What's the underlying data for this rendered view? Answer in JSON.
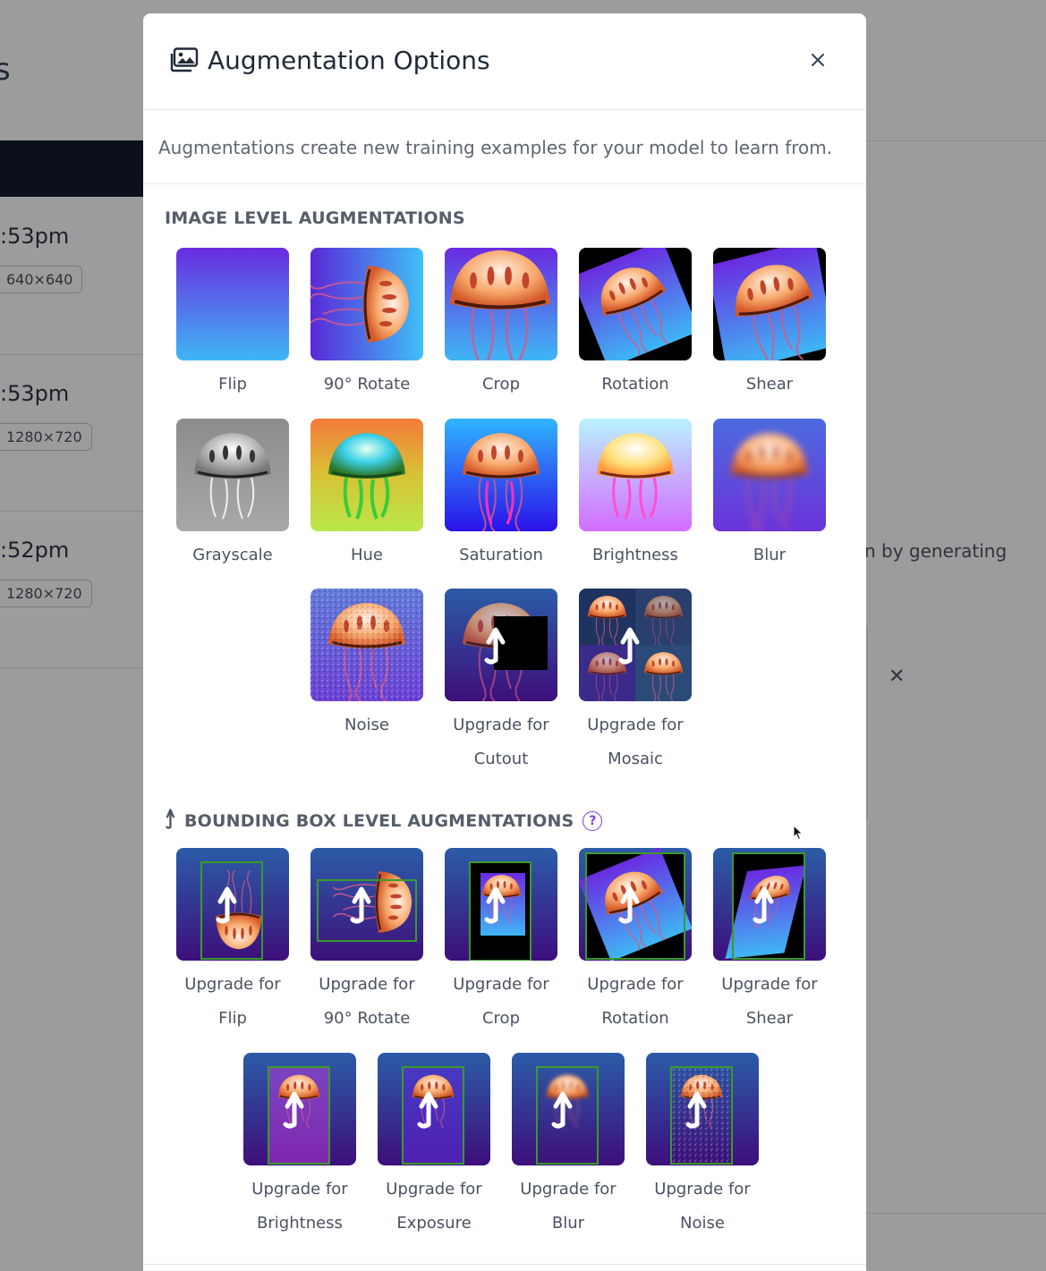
{
  "background": {
    "title_fragment": "s",
    "rows": [
      {
        "time": ":53pm",
        "dims": "640×640"
      },
      {
        "time": ":53pm",
        "dims": "1280×720"
      },
      {
        "time": ":52pm",
        "dims": "1280×720"
      }
    ],
    "side_text": "n by generating",
    "close_glyph": "✕"
  },
  "modal": {
    "title": "Augmentation Options",
    "close_glyph": "✕",
    "description": "Augmentations create new training examples for your model to learn from.",
    "image_section": {
      "title": "IMAGE LEVEL AUGMENTATIONS",
      "items": [
        {
          "label": "Flip"
        },
        {
          "label": "90° Rotate"
        },
        {
          "label": "Crop"
        },
        {
          "label": "Rotation"
        },
        {
          "label": "Shear"
        },
        {
          "label": "Grayscale"
        },
        {
          "label": "Hue"
        },
        {
          "label": "Saturation"
        },
        {
          "label": "Brightness"
        },
        {
          "label": "Blur"
        },
        {
          "label": "Noise"
        },
        {
          "label": "Upgrade for Cutout",
          "label_line1": "Upgrade for",
          "label_line2": "Cutout"
        },
        {
          "label": "Upgrade for Mosaic",
          "label_line1": "Upgrade for",
          "label_line2": "Mosaic"
        }
      ]
    },
    "bbox_section": {
      "title": "BOUNDING BOX LEVEL AUGMENTATIONS",
      "help_glyph": "?",
      "items": [
        {
          "label_line1": "Upgrade for",
          "label_line2": "Flip"
        },
        {
          "label_line1": "Upgrade for",
          "label_line2": "90° Rotate"
        },
        {
          "label_line1": "Upgrade for",
          "label_line2": "Crop"
        },
        {
          "label_line1": "Upgrade for",
          "label_line2": "Rotation"
        },
        {
          "label_line1": "Upgrade for",
          "label_line2": "Shear"
        },
        {
          "label_line1": "Upgrade for",
          "label_line2": "Brightness"
        },
        {
          "label_line1": "Upgrade for",
          "label_line2": "Exposure"
        },
        {
          "label_line1": "Upgrade for",
          "label_line2": "Blur"
        },
        {
          "label_line1": "Upgrade for",
          "label_line2": "Noise"
        }
      ]
    },
    "colors": {
      "accent": "#7c3aed",
      "upgrade_arrow": "#ffffff"
    }
  }
}
